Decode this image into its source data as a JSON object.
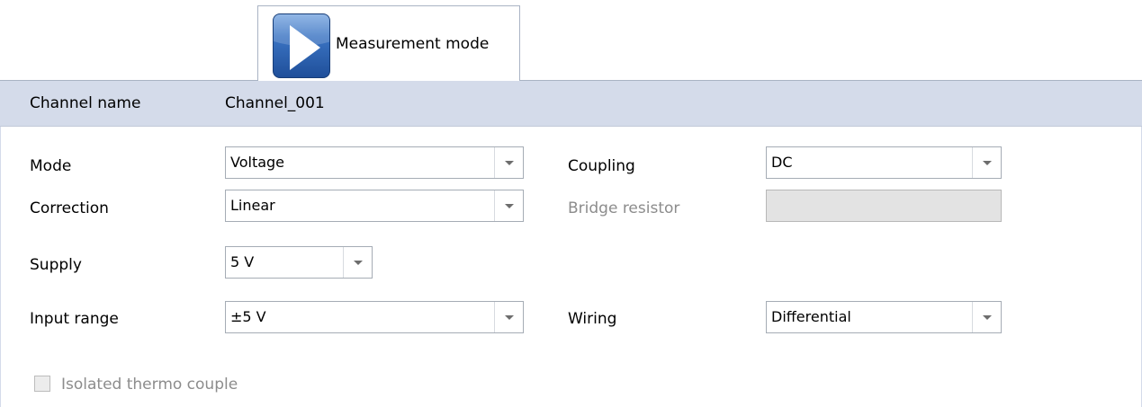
{
  "tab": {
    "label": "Measurement mode",
    "icon": "play-icon"
  },
  "channel": {
    "name_label": "Channel name",
    "name_value": "Channel_001"
  },
  "fields": {
    "mode": {
      "label": "Mode",
      "value": "Voltage"
    },
    "correction": {
      "label": "Correction",
      "value": "Linear"
    },
    "supply": {
      "label": "Supply",
      "value": "5 V"
    },
    "input_range": {
      "label": "Input range",
      "value": "±5 V"
    },
    "coupling": {
      "label": "Coupling",
      "value": "DC"
    },
    "bridge_resistor": {
      "label": "Bridge resistor",
      "value": "",
      "enabled": false
    },
    "wiring": {
      "label": "Wiring",
      "value": "Differential"
    }
  },
  "isolated_thermo_couple": {
    "label": "Isolated thermo couple",
    "checked": false,
    "enabled": false
  },
  "colors": {
    "header_band": "#d4dbea",
    "icon_blue": "#2a5ea9",
    "disabled_text": "#8c8c8c",
    "disabled_field": "#e3e3e3"
  }
}
